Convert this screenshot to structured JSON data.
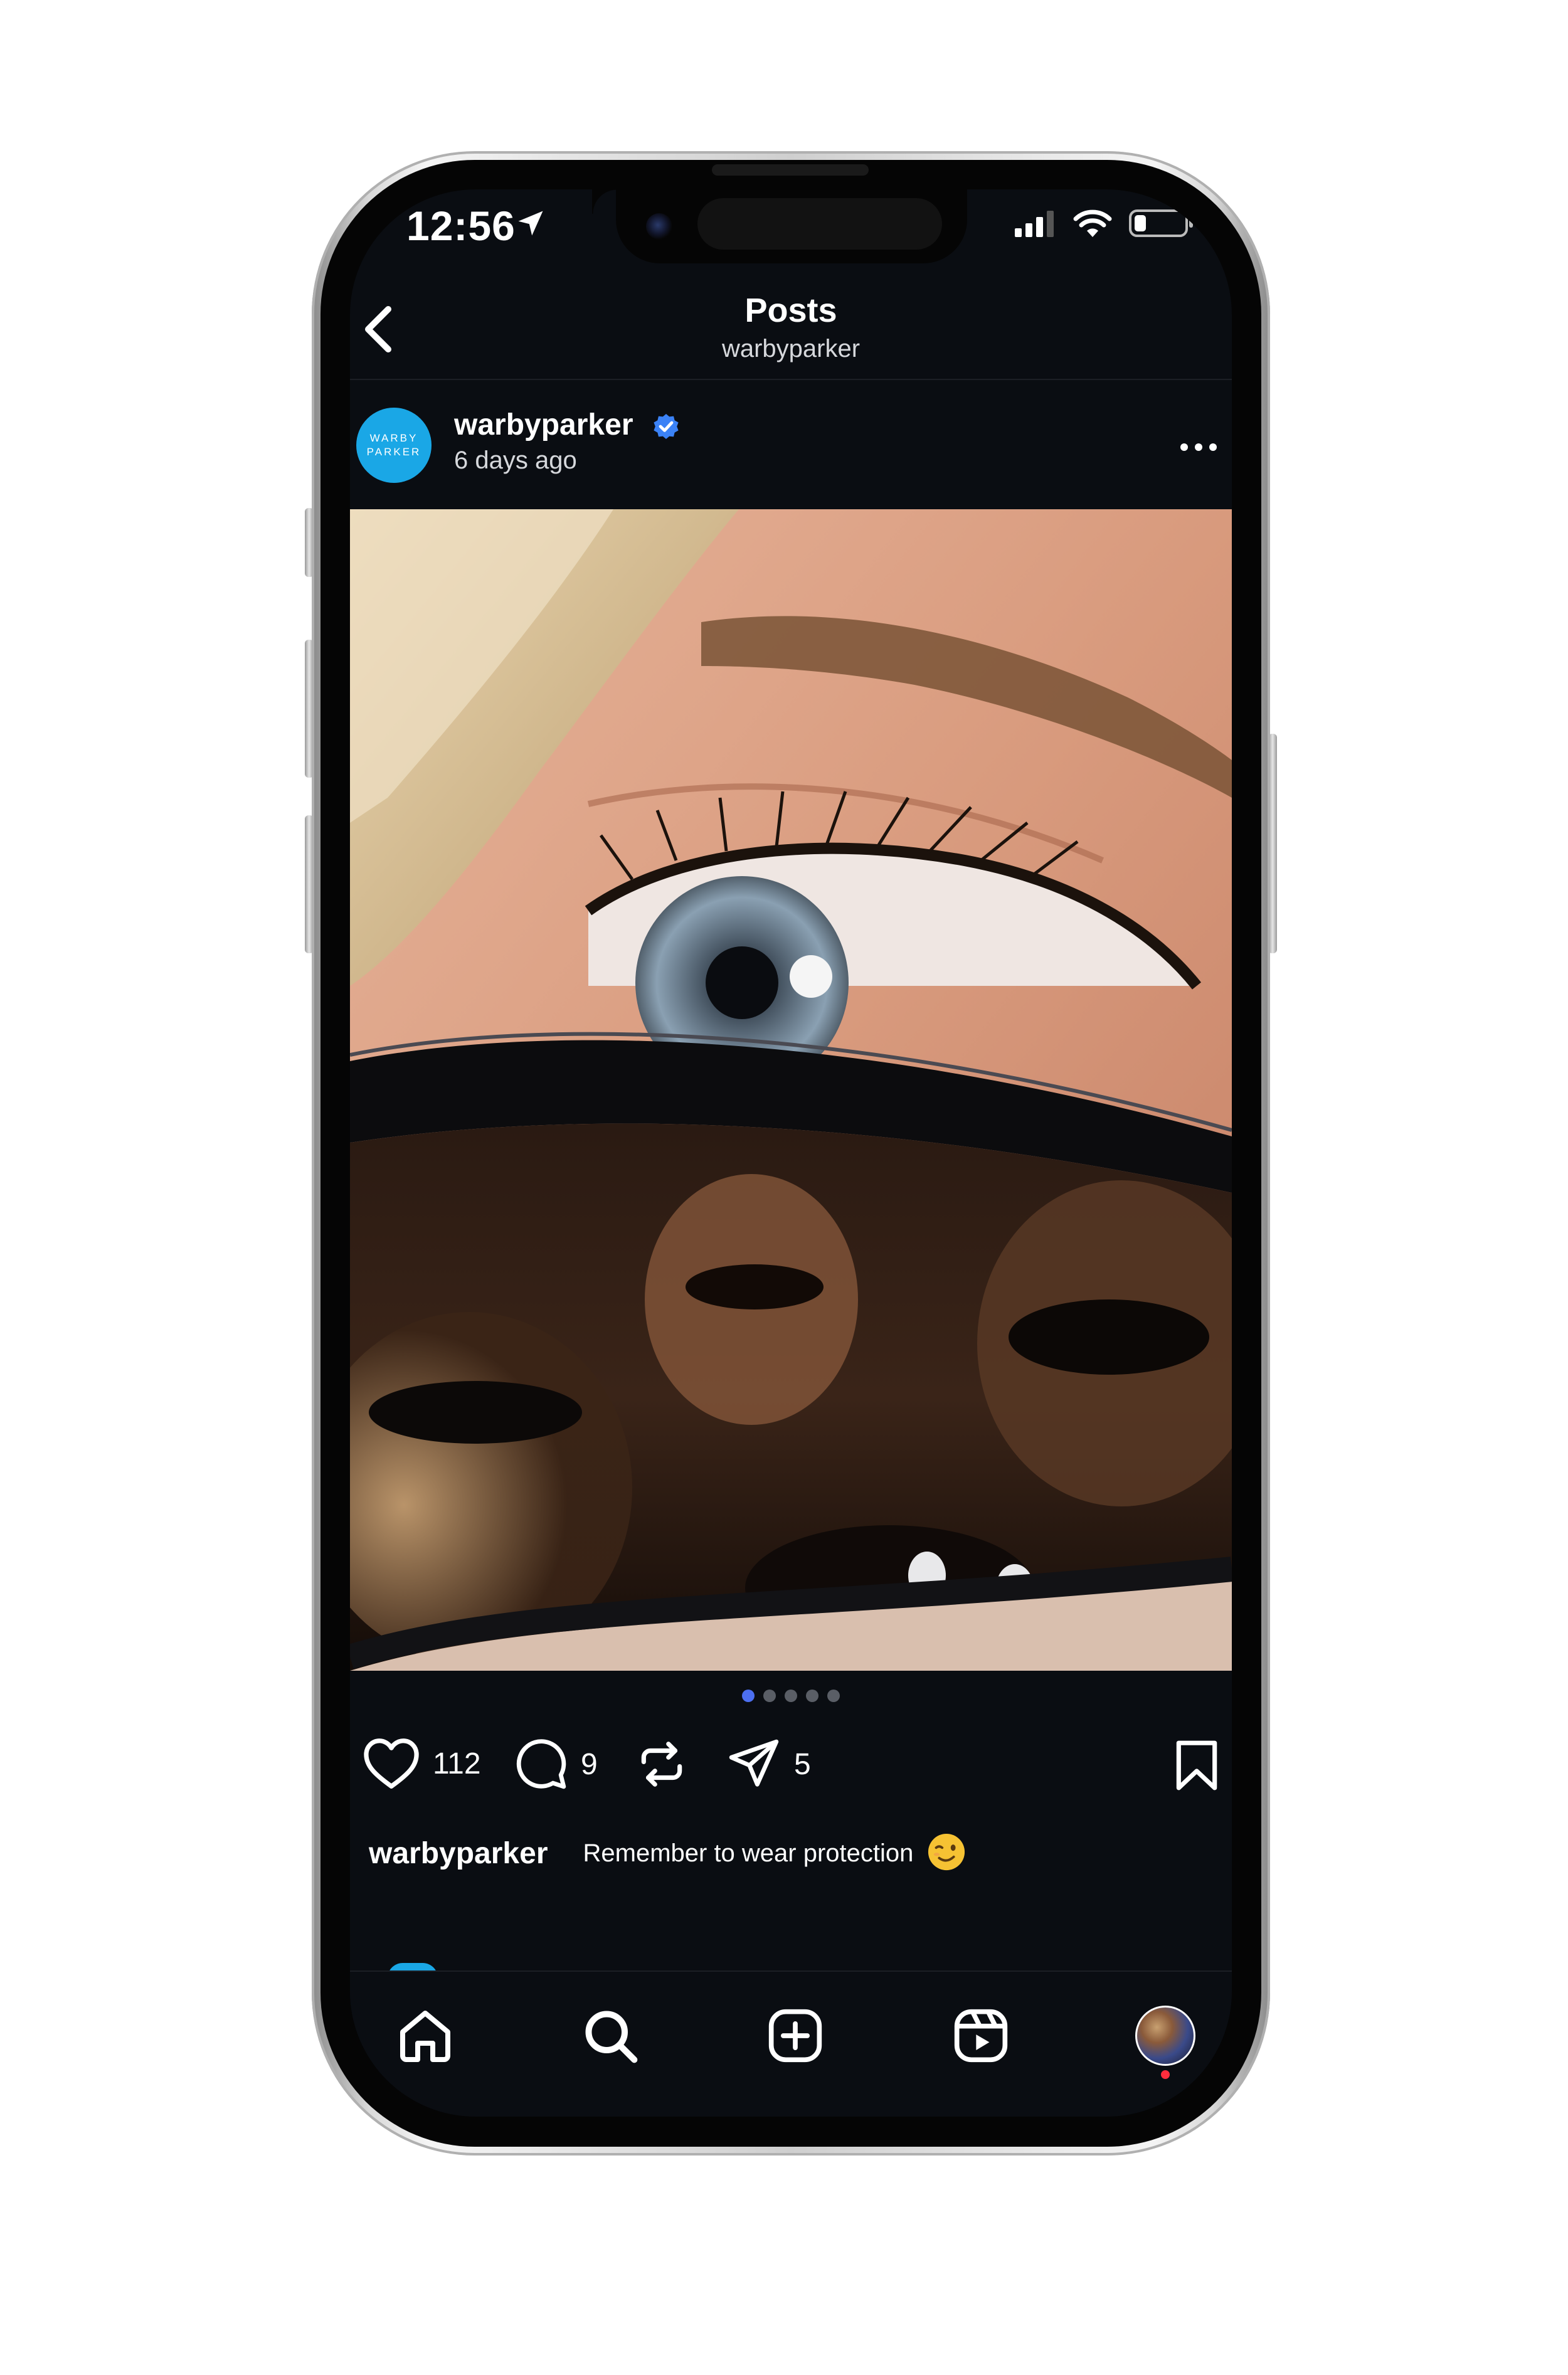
{
  "status_bar": {
    "time": "12:56"
  },
  "header": {
    "title": "Posts",
    "subtitle": "warbyparker"
  },
  "post": {
    "avatar_text_line1": "WARBY",
    "avatar_text_line2": "PARKER",
    "username": "warbyparker",
    "time_ago": "6 days ago",
    "carousel": {
      "count": 5,
      "active_index": 0
    },
    "likes": "112",
    "comments": "9",
    "shares": "5",
    "caption_user": "warbyparker",
    "caption_text": "Remember to wear protection"
  },
  "colors": {
    "background": "#0a0d12",
    "brand_avatar": "#1aa7e6",
    "verified": "#3b82f6",
    "active_dot": "#4c6ff0",
    "notification_dot": "#ff2d3d"
  },
  "icons": [
    "back-chevron-icon",
    "location-arrow-icon",
    "signal-icon",
    "wifi-icon",
    "battery-icon",
    "verified-icon",
    "more-icon",
    "heart-icon",
    "comment-icon",
    "repost-icon",
    "share-icon",
    "bookmark-icon",
    "home-icon",
    "search-icon",
    "create-icon",
    "reels-icon",
    "wink-emoji-icon"
  ]
}
